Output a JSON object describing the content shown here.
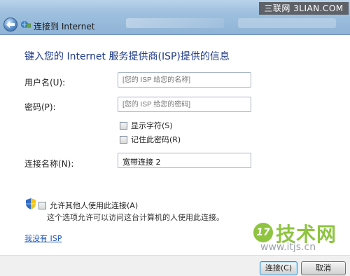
{
  "window": {
    "title": "连接到 Internet"
  },
  "watermark": {
    "top": "三联网 3LIAN.COM",
    "logo": "17",
    "brand": "技术网",
    "url": "www.itjs.cn"
  },
  "heading": "键入您的 Internet 服务提供商(ISP)提供的信息",
  "username": {
    "label": "用户名(U):",
    "placeholder": "[您的 ISP 给您的名称]"
  },
  "password": {
    "label": "密码(P):",
    "placeholder": "[您的 ISP 给您的密码]"
  },
  "options": {
    "show_chars": "显示字符(S)",
    "remember_password": "记住此密码(R)"
  },
  "connection_name": {
    "label": "连接名称(N):",
    "value": "宽带连接 2"
  },
  "allow": {
    "label": "允许其他人使用此连接(A)",
    "description": "这个选项允许可以访问这台计算机的人使用此连接。"
  },
  "no_isp_link": "我没有 ISP",
  "buttons": {
    "connect": "连接(C)",
    "cancel": "取消"
  }
}
